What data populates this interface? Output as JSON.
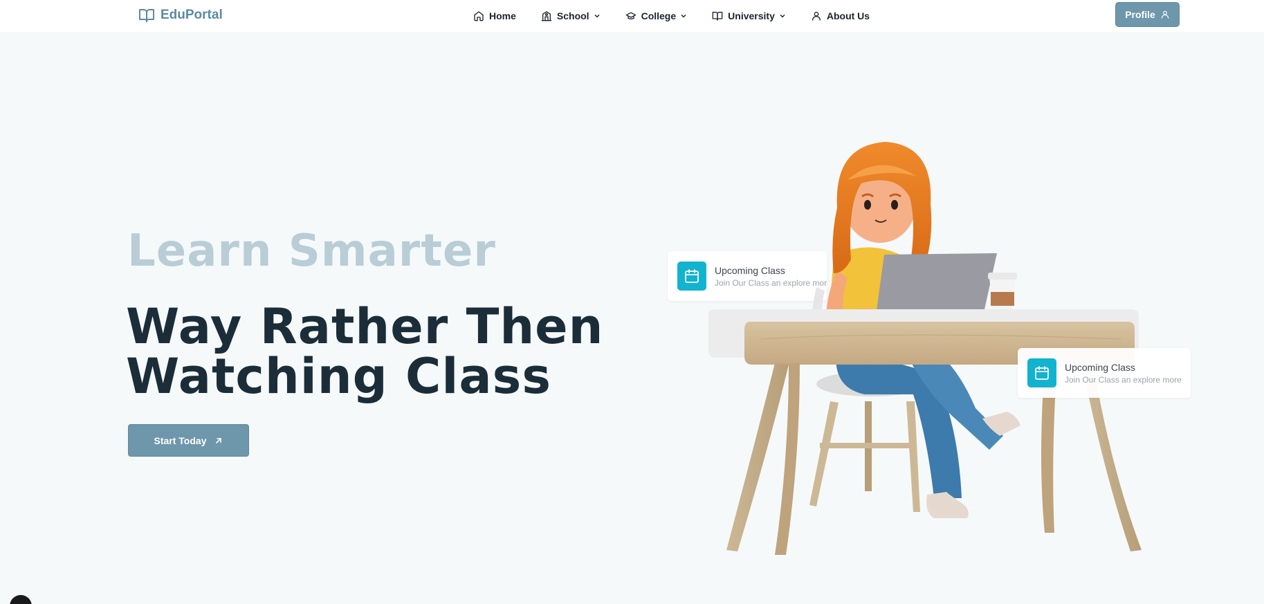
{
  "brand": {
    "name": "EduPortal",
    "icon": "book-open-icon"
  },
  "nav": {
    "items": [
      {
        "label": "Home",
        "icon": "home-icon",
        "dropdown": false
      },
      {
        "label": "School",
        "icon": "school-icon",
        "dropdown": true
      },
      {
        "label": "College",
        "icon": "graduation-cap-icon",
        "dropdown": true
      },
      {
        "label": "University",
        "icon": "book-open-icon",
        "dropdown": true
      },
      {
        "label": "About Us",
        "icon": "user-icon",
        "dropdown": false
      }
    ],
    "profile_label": "Profile"
  },
  "hero": {
    "subtitle": "Learn Smarter",
    "title_line1": "Way Rather Then",
    "title_line2": "Watching Class",
    "cta_label": "Start Today"
  },
  "cards": [
    {
      "title": "Upcoming Class",
      "description": "Join Our Class an explore more",
      "icon": "calendar-icon"
    },
    {
      "title": "Upcoming Class",
      "description": "Join Our Class an explore more",
      "icon": "calendar-icon"
    }
  ],
  "colors": {
    "accent": "#6e97ab",
    "card_icon_bg": "#11b3cf",
    "heading": "#1b2d38",
    "subheading": "#b9cdd6",
    "background": "#f5f9fa"
  }
}
